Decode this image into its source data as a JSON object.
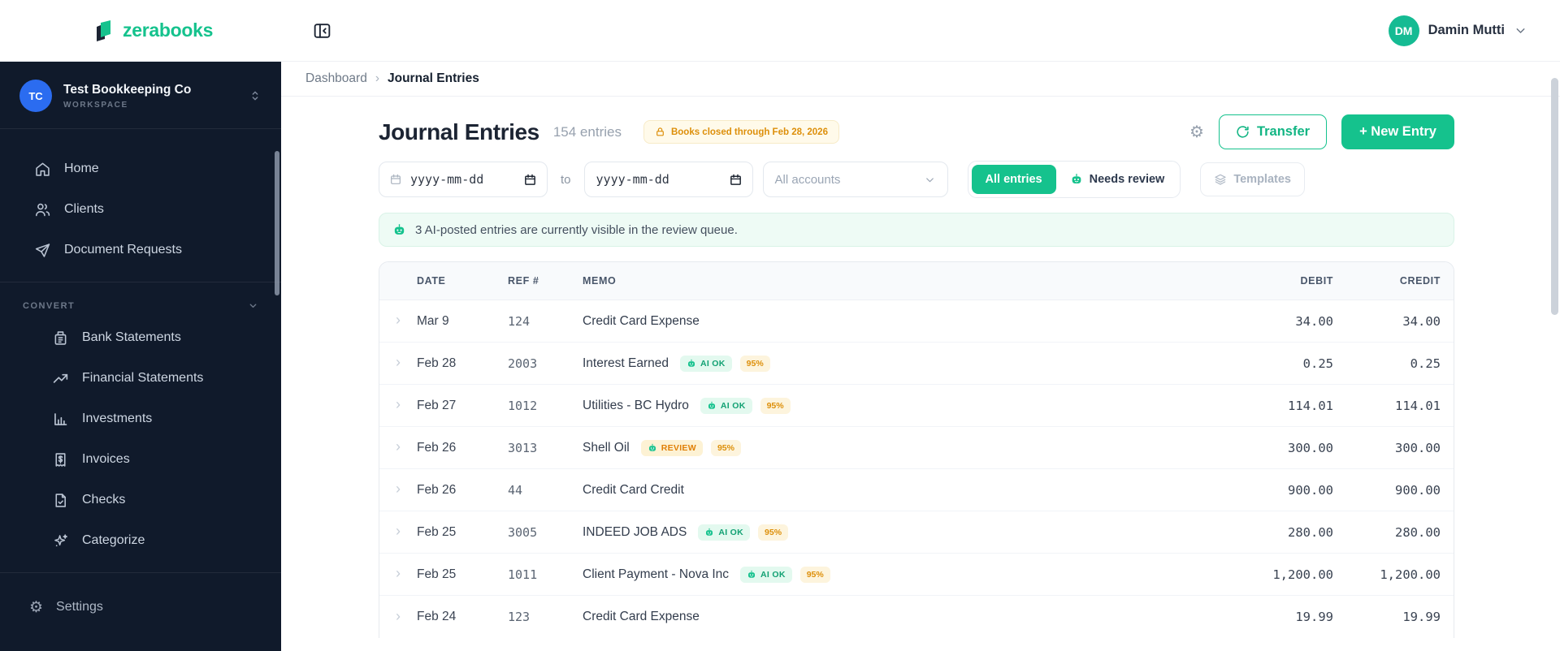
{
  "brand": {
    "name": "zerabooks"
  },
  "header": {
    "user_initials": "DM",
    "user_name": "Damin Mutti"
  },
  "breadcrumb": {
    "home": "Dashboard",
    "separator": "›",
    "current": "Journal Entries"
  },
  "sidebar": {
    "workspace_initials": "TC",
    "workspace_name": "Test Bookkeeping Co",
    "workspace_label": "WORKSPACE",
    "nav": [
      {
        "label": "Home"
      },
      {
        "label": "Clients"
      },
      {
        "label": "Document Requests"
      }
    ],
    "convert_label": "CONVERT",
    "convert": [
      {
        "label": "Bank Statements"
      },
      {
        "label": "Financial Statements"
      },
      {
        "label": "Investments"
      },
      {
        "label": "Invoices"
      },
      {
        "label": "Checks"
      },
      {
        "label": "Categorize"
      }
    ],
    "settings_label": "Settings"
  },
  "page": {
    "title": "Journal Entries",
    "count": "154 entries",
    "closed_badge": "Books closed through Feb 28, 2026",
    "transfer": "Transfer",
    "new_entry": "+ New Entry"
  },
  "filters": {
    "date_from_placeholder": "yyyy-mm-dd",
    "to": "to",
    "date_to_placeholder": "yyyy-mm-dd",
    "accounts": "All accounts",
    "tab_all": "All entries",
    "tab_review": "Needs review",
    "templates": "Templates"
  },
  "banner": {
    "text": "3 AI-posted entries are currently visible in the review queue."
  },
  "table": {
    "headers": {
      "date": "DATE",
      "ref": "REF #",
      "memo": "MEMO",
      "debit": "DEBIT",
      "credit": "CREDIT"
    },
    "rows": [
      {
        "date": "Mar 9",
        "ref": "124",
        "memo": "Credit Card Expense",
        "ai": null,
        "conf": null,
        "debit": "34.00",
        "credit": "34.00"
      },
      {
        "date": "Feb 28",
        "ref": "2003",
        "memo": "Interest Earned",
        "ai": "AI OK",
        "conf": "95%",
        "debit": "0.25",
        "credit": "0.25"
      },
      {
        "date": "Feb 27",
        "ref": "1012",
        "memo": "Utilities - BC Hydro",
        "ai": "AI OK",
        "conf": "95%",
        "debit": "114.01",
        "credit": "114.01"
      },
      {
        "date": "Feb 26",
        "ref": "3013",
        "memo": "Shell Oil",
        "ai": "REVIEW",
        "conf": "95%",
        "debit": "300.00",
        "credit": "300.00"
      },
      {
        "date": "Feb 26",
        "ref": "44",
        "memo": "Credit Card Credit",
        "ai": null,
        "conf": null,
        "debit": "900.00",
        "credit": "900.00"
      },
      {
        "date": "Feb 25",
        "ref": "3005",
        "memo": "INDEED JOB ADS",
        "ai": "AI OK",
        "conf": "95%",
        "debit": "280.00",
        "credit": "280.00"
      },
      {
        "date": "Feb 25",
        "ref": "1011",
        "memo": "Client Payment - Nova Inc",
        "ai": "AI OK",
        "conf": "95%",
        "debit": "1,200.00",
        "credit": "1,200.00"
      },
      {
        "date": "Feb 24",
        "ref": "123",
        "memo": "Credit Card Expense",
        "ai": null,
        "conf": null,
        "debit": "19.99",
        "credit": "19.99"
      }
    ]
  },
  "icons": {
    "gear_glyph": "⚙",
    "row_chevron": "›"
  },
  "colors": {
    "accent": "#15c28d",
    "sidebar_bg": "#101a2b",
    "warning": "#dd8f0a"
  }
}
